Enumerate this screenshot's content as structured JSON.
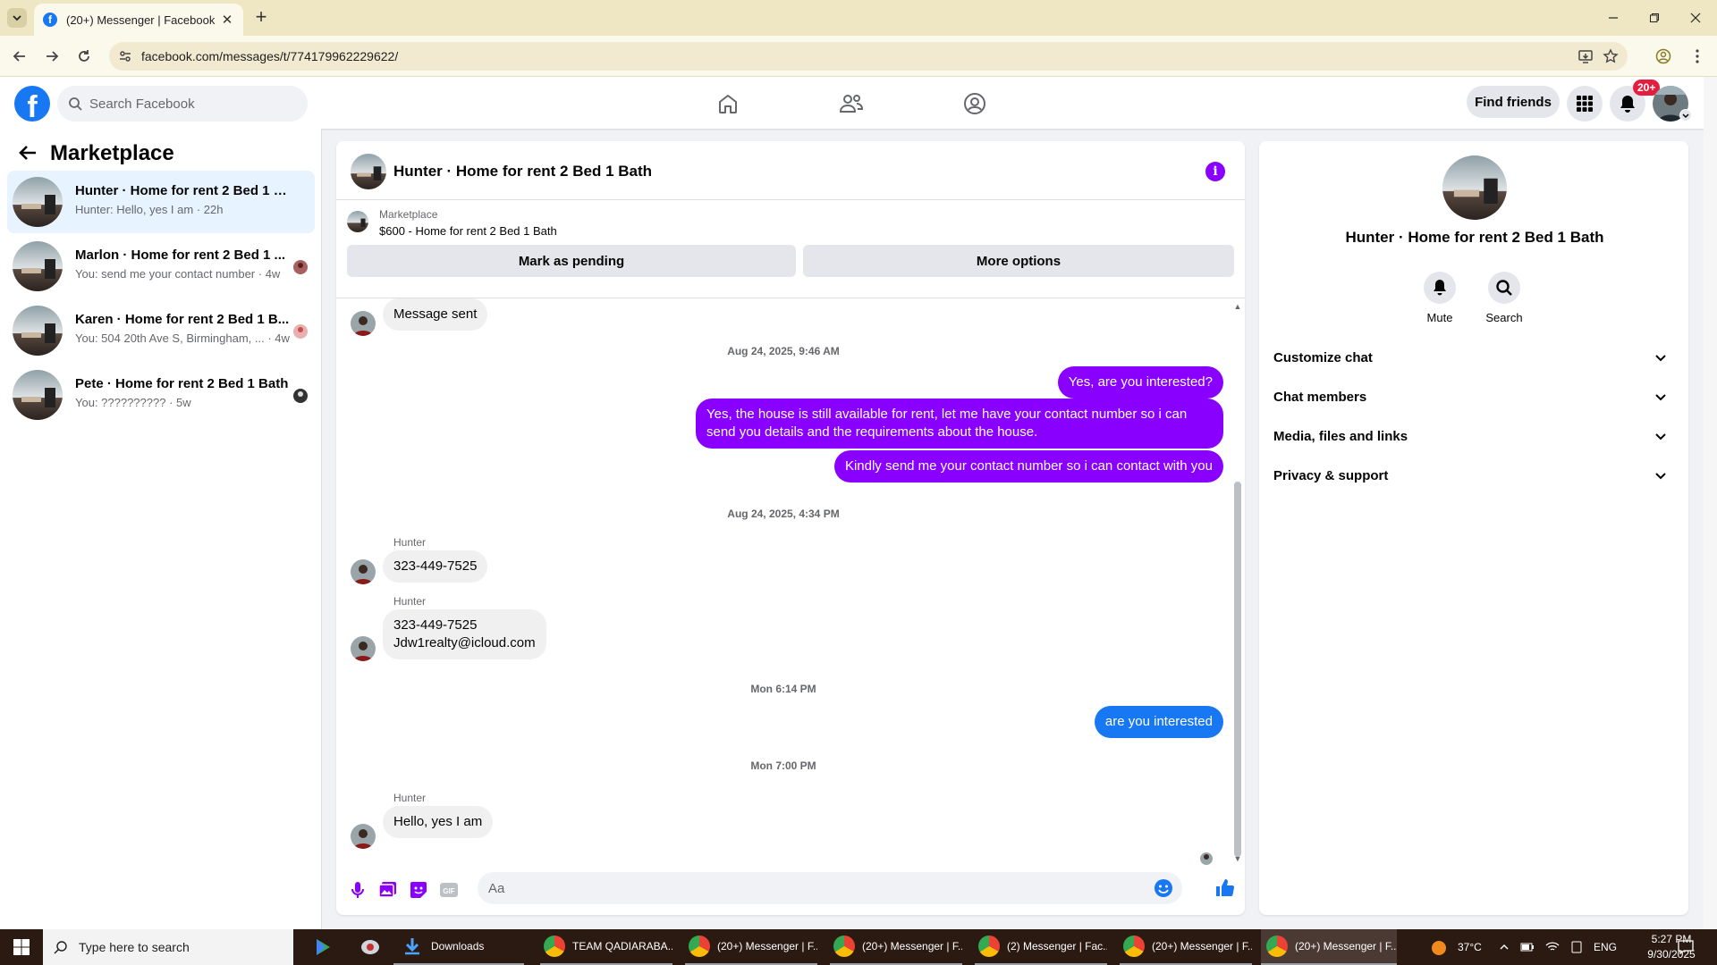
{
  "browser": {
    "tab_title": "(20+) Messenger | Facebook",
    "url": "facebook.com/messages/t/774179962229622/"
  },
  "fb_header": {
    "search_placeholder": "Search Facebook",
    "find_friends": "Find friends",
    "notif_badge": "20+"
  },
  "sidebar": {
    "title": "Marketplace",
    "conversations": [
      {
        "name": "Hunter · Home for rent 2 Bed 1 Bath",
        "preview": "Hunter: Hello, yes I am · 22h"
      },
      {
        "name": "Marlon · Home for rent 2 Bed 1 ...",
        "preview": "You: send me your contact number · 4w"
      },
      {
        "name": "Karen · Home for rent 2 Bed 1 B...",
        "preview": "You: 504 20th Ave S, Birmingham, ... · 4w"
      },
      {
        "name": "Pete · Home for rent 2 Bed 1 Bath",
        "preview": "You: ?????????? · 5w"
      }
    ]
  },
  "chat": {
    "title": "Hunter · Home for rent 2 Bed 1 Bath",
    "marketplace_label": "Marketplace",
    "listing": "$600 - Home for rent 2 Bed 1 Bath",
    "mark_pending": "Mark as pending",
    "more_options": "More options",
    "messages": {
      "m0": "Message sent",
      "ts1": "Aug 24, 2025, 9:46 AM",
      "m1": "Yes, are you interested?",
      "m2": "Yes, the house is still available for rent, let me have your contact number so i can send you details and the requirements about the house.",
      "m3": "Kindly send me your contact number so i can contact with you",
      "ts2": "Aug 24, 2025, 4:34 PM",
      "sender": "Hunter",
      "m4": "323-449-7525",
      "m5_line1": "323-449-7525",
      "m5_line2": "Jdw1realty@icloud.com",
      "ts3": "Mon 6:14 PM",
      "m6": "are you interested",
      "ts4": "Mon 7:00 PM",
      "m7": "Hello, yes I am"
    },
    "composer_placeholder": "Aa"
  },
  "info_panel": {
    "name": "Hunter · Home for rent 2 Bed 1 Bath",
    "mute": "Mute",
    "search": "Search",
    "sections": [
      "Customize chat",
      "Chat members",
      "Media, files and links",
      "Privacy & support"
    ]
  },
  "taskbar": {
    "search": "Type here to search",
    "apps": [
      "Downloads",
      "TEAM QADIARABA...",
      "(20+) Messenger | F...",
      "(20+) Messenger | F...",
      "(2) Messenger | Fac...",
      "(20+) Messenger | F...",
      "(20+) Messenger | F..."
    ],
    "temperature": "37°C",
    "language": "ENG",
    "time": "5:27 PM",
    "date": "9/30/2025"
  },
  "colors": {
    "accent_purple": "#8a00ff",
    "facebook_blue": "#1877f2",
    "notification_red": "#e41e3f",
    "tab_bar": "#efe7c4"
  }
}
